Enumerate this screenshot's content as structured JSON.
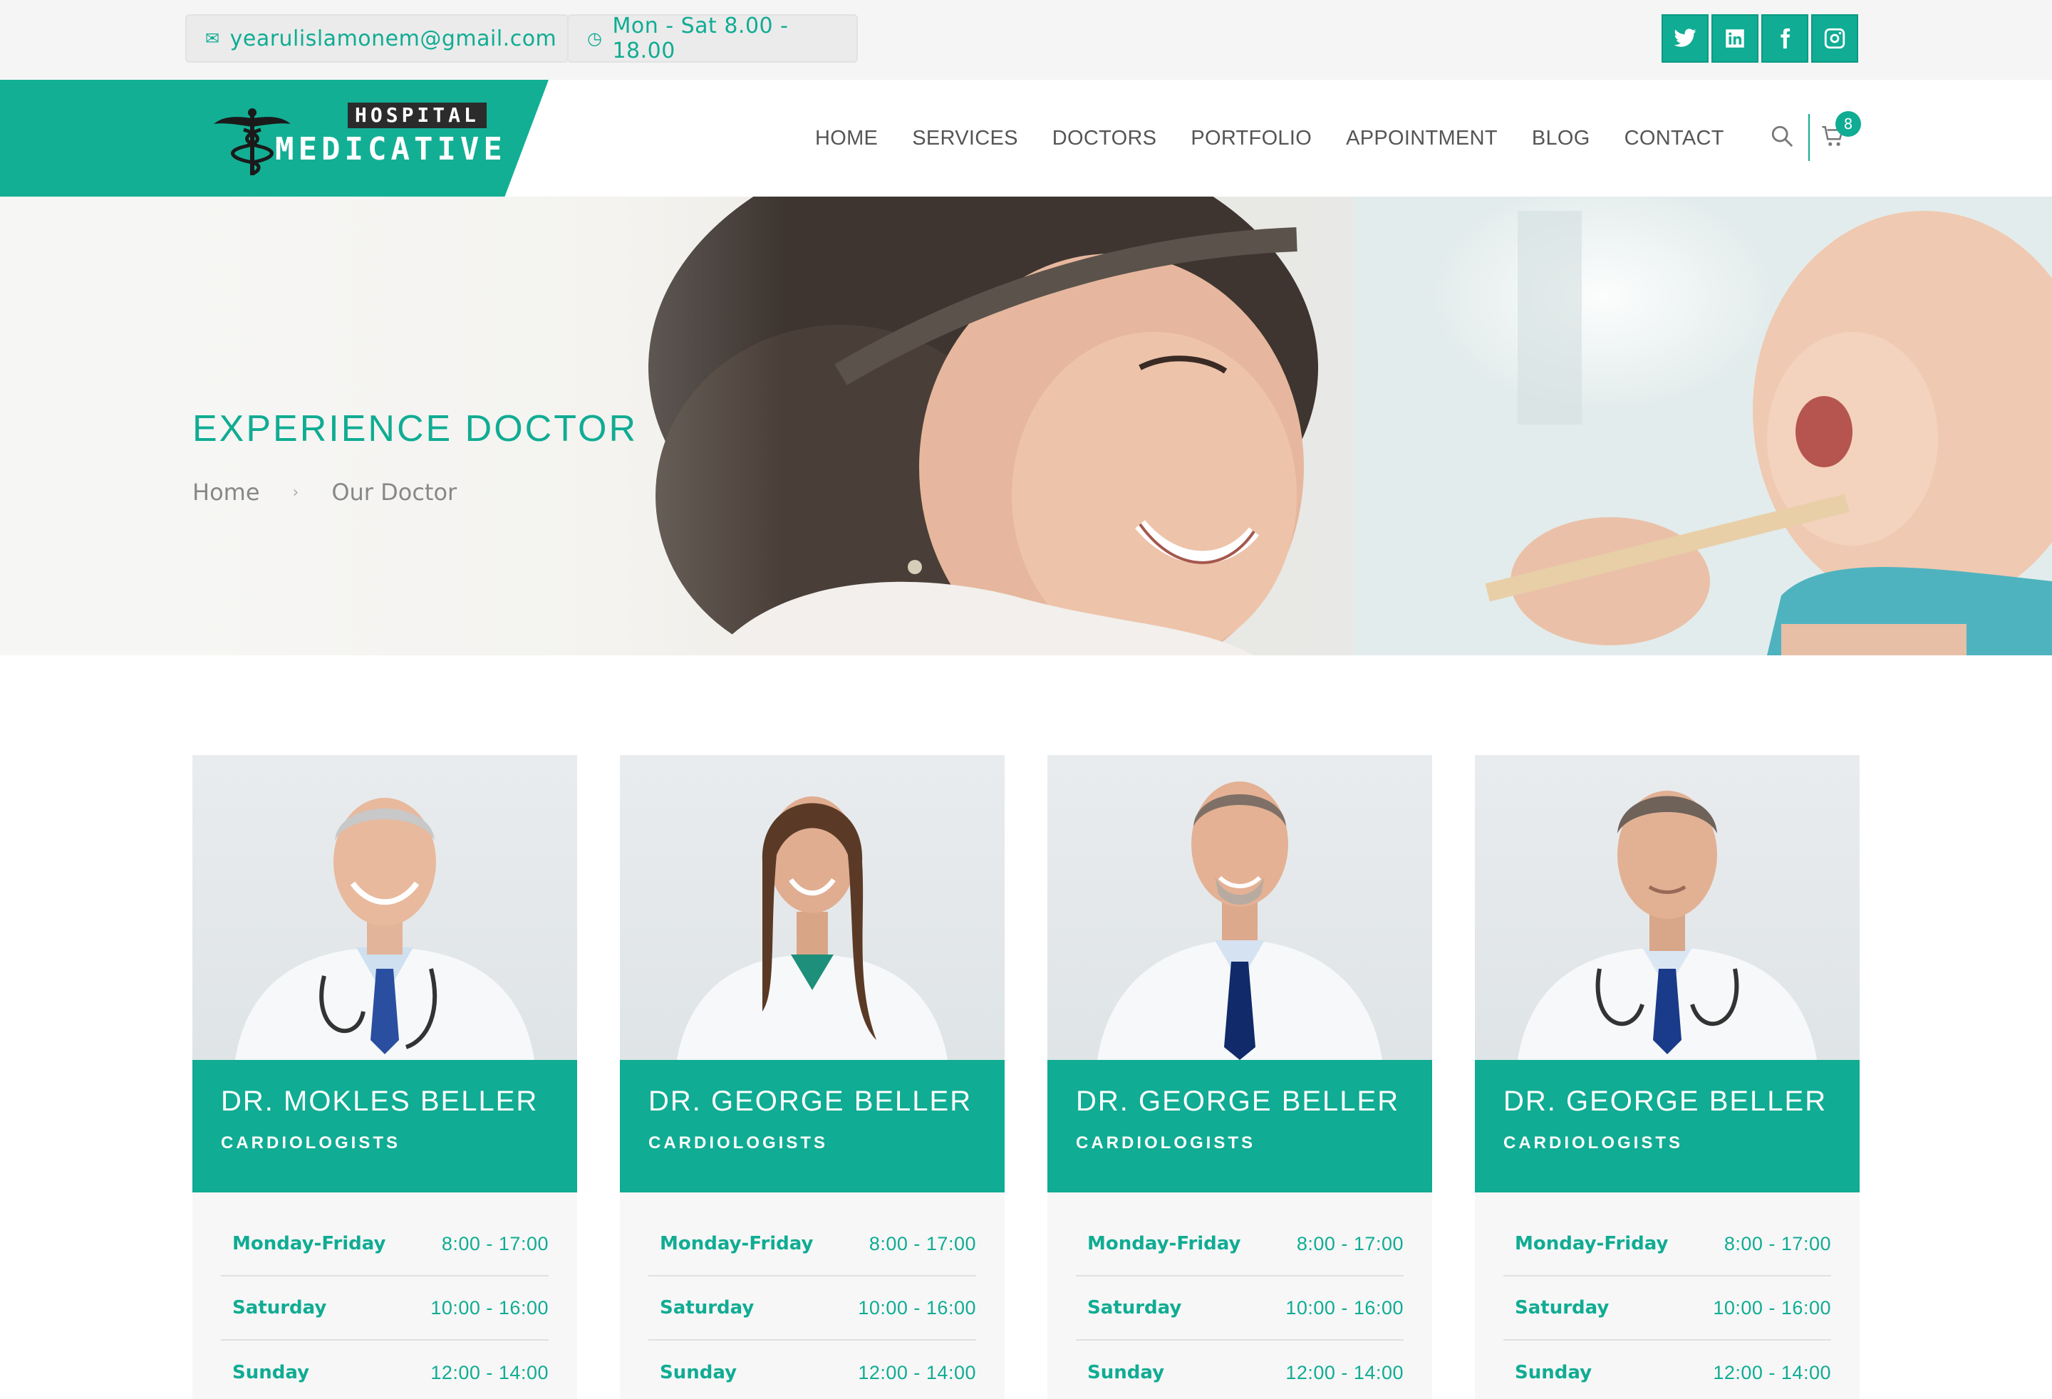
{
  "topbar": {
    "email": "yearulislamonem@gmail.com",
    "hours": "Mon - Sat 8.00 - 18.00",
    "socials": [
      "twitter-icon",
      "linkedin-icon",
      "facebook-icon",
      "instagram-icon"
    ]
  },
  "logo": {
    "top": "HOSPITAL",
    "main": "MEDICATIVE"
  },
  "nav": {
    "items": [
      "HOME",
      "SERVICES",
      "DOCTORS",
      "PORTFOLIO",
      "APPOINTMENT",
      "BLOG",
      "CONTACT"
    ],
    "cart_count": "8"
  },
  "hero": {
    "title": "EXPERIENCE DOCTOR",
    "breadcrumb": [
      "Home",
      "Our Doctor"
    ]
  },
  "colors": {
    "accent": "#10ac93",
    "accent_dark": "#0a9a83",
    "text": "#555555"
  },
  "doctors": [
    {
      "name": "DR. MOKLES BELLER",
      "role": "CARDIOLOGISTS",
      "hours": [
        {
          "day": "Monday-Friday",
          "time": "8:00 - 17:00"
        },
        {
          "day": "Saturday",
          "time": "10:00 - 16:00"
        },
        {
          "day": "Sunday",
          "time": "12:00 - 14:00"
        }
      ]
    },
    {
      "name": "DR. GEORGE BELLER",
      "role": "CARDIOLOGISTS",
      "hours": [
        {
          "day": "Monday-Friday",
          "time": "8:00 - 17:00"
        },
        {
          "day": "Saturday",
          "time": "10:00 - 16:00"
        },
        {
          "day": "Sunday",
          "time": "12:00 - 14:00"
        }
      ]
    },
    {
      "name": "DR. GEORGE BELLER",
      "role": "CARDIOLOGISTS",
      "hours": [
        {
          "day": "Monday-Friday",
          "time": "8:00 - 17:00"
        },
        {
          "day": "Saturday",
          "time": "10:00 - 16:00"
        },
        {
          "day": "Sunday",
          "time": "12:00 - 14:00"
        }
      ]
    },
    {
      "name": "DR. GEORGE BELLER",
      "role": "CARDIOLOGISTS",
      "hours": [
        {
          "day": "Monday-Friday",
          "time": "8:00 - 17:00"
        },
        {
          "day": "Saturday",
          "time": "10:00 - 16:00"
        },
        {
          "day": "Sunday",
          "time": "12:00 - 14:00"
        }
      ]
    }
  ]
}
